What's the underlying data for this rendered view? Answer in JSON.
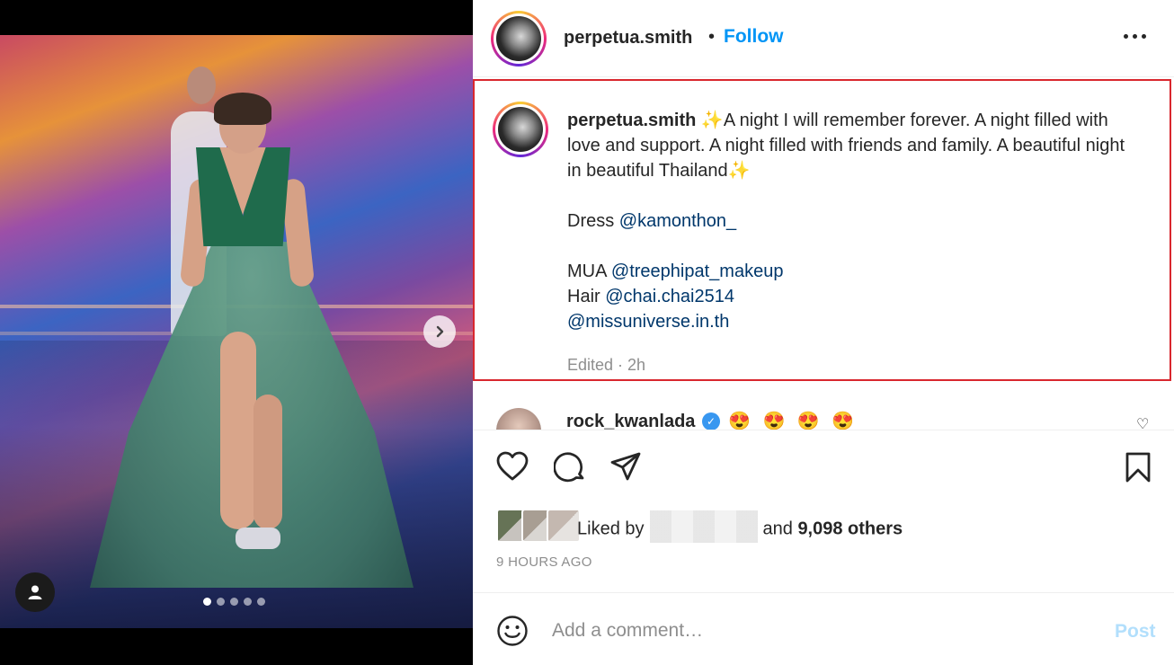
{
  "post": {
    "username": "perpetua.smith",
    "separator": "•",
    "follow_label": "Follow",
    "more_icon": "more-horizontal-icon"
  },
  "caption": {
    "username": "perpetua.smith",
    "line1_prefix": "✨",
    "line1_text": "A night I will remember forever. A night filled with love and support. A night filled with friends and family. A beautiful night in beautiful Thailand",
    "line1_suffix": "✨",
    "dress_label": "Dress",
    "dress_mention": "@kamonthon_",
    "mua_label": "MUA",
    "mua_mention": "@treephipat_makeup",
    "hair_label": "Hair",
    "hair_mention": "@chai.chai2514",
    "org_mention": "@missuniverse.in.th",
    "meta": "Edited · 2h"
  },
  "next_comment": {
    "username": "rock_kwanlada",
    "verified": true,
    "emojis": "😍 😍 😍 😍"
  },
  "media": {
    "carousel_count": 5,
    "active_index": 0
  },
  "engagement": {
    "liked_by_prefix": "Liked by",
    "liked_by_middle": "and",
    "others_count": "9,098 others",
    "time_ago": "9 HOURS AGO"
  },
  "comment_box": {
    "placeholder": "Add a comment…",
    "post_label": "Post"
  },
  "colors": {
    "accent": "#0095f6",
    "mention": "#00376b",
    "highlight_border": "#d9272e",
    "post_disabled": "#b2dffc"
  }
}
